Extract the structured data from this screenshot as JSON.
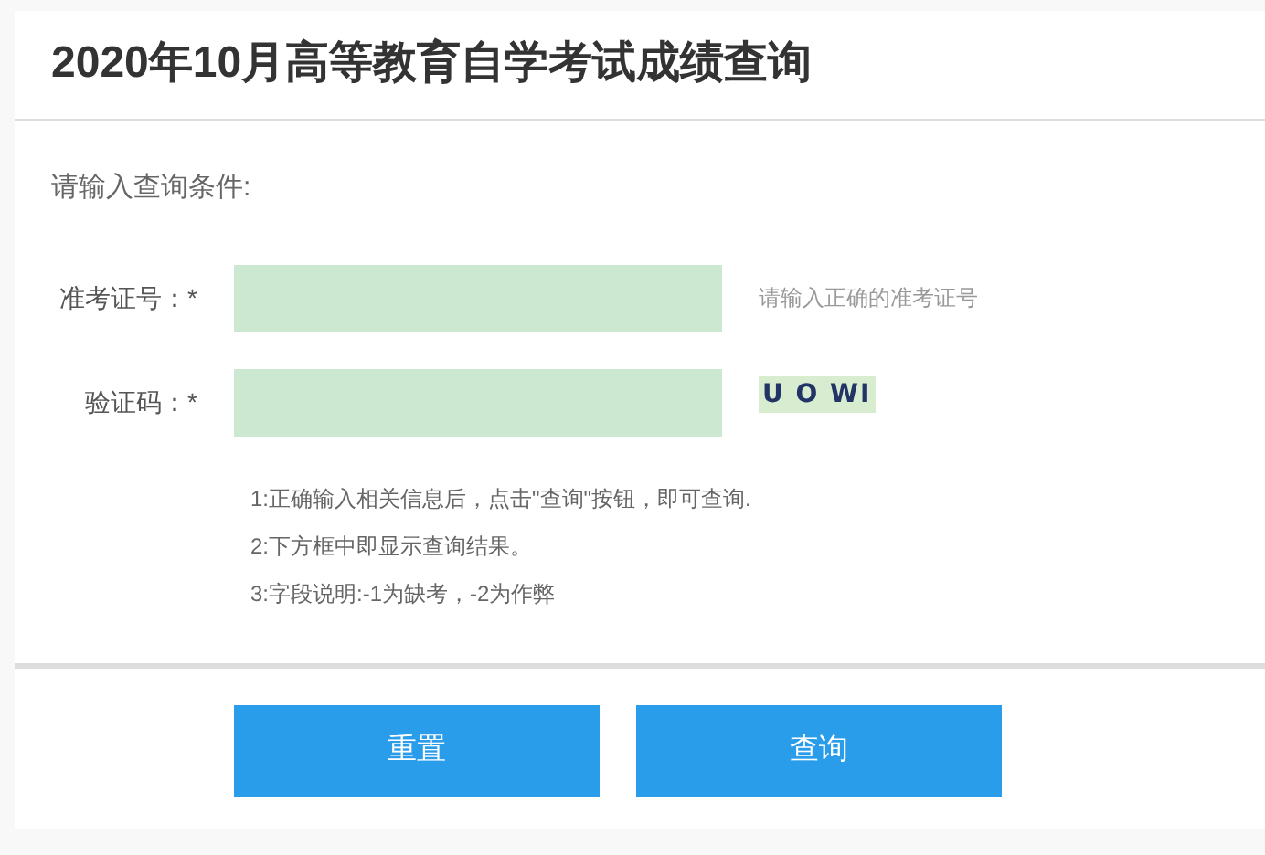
{
  "title": "2020年10月高等教育自学考试成绩查询",
  "prompt": "请输入查询条件:",
  "fields": [
    {
      "label": "准考证号：*",
      "hint": "请输入正确的准考证号"
    },
    {
      "label": "验证码：*",
      "captcha": "U O WI"
    }
  ],
  "notes": [
    "1:正确输入相关信息后，点击\"查询\"按钮，即可查询.",
    "2:下方框中即显示查询结果。",
    "3:字段说明:-1为缺考，-2为作弊"
  ],
  "buttons": [
    "重置",
    "查询"
  ]
}
